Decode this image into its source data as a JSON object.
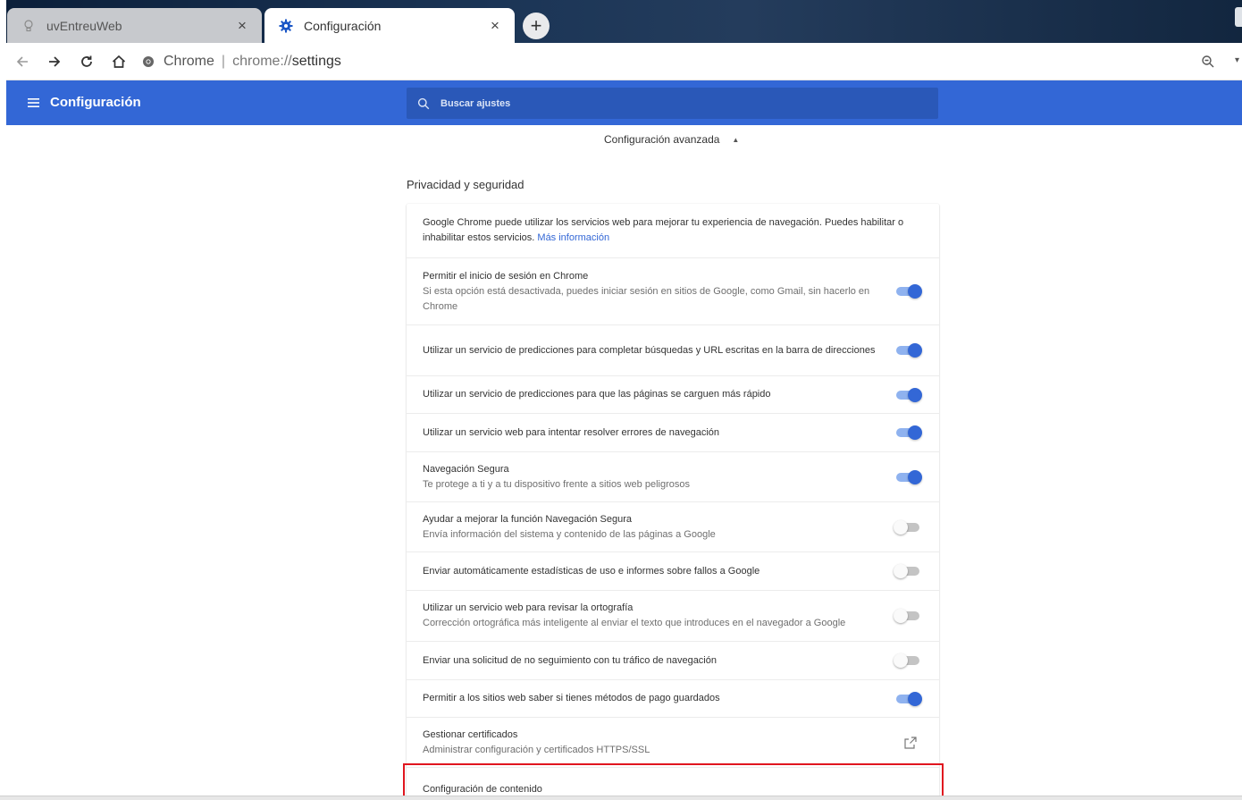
{
  "tabs": [
    {
      "title": "uvEntreuWeb",
      "icon": "bulb-icon",
      "active": false,
      "close": "×"
    },
    {
      "title": "Configuración",
      "icon": "gear-icon",
      "active": true,
      "close": "×"
    }
  ],
  "new_tab_label": "+",
  "toolbar": {
    "site_label": "Chrome",
    "separator": "|",
    "url_scheme": "chrome://",
    "url_path": "settings"
  },
  "header": {
    "title": "Configuración",
    "search_placeholder": "Buscar ajustes"
  },
  "advanced": {
    "label": "Configuración avanzada",
    "caret": "▲"
  },
  "section": {
    "title": "Privacidad y seguridad",
    "intro": "Google Chrome puede utilizar los servicios web para mejorar tu experiencia de navegación. Puedes habilitar o inhabilitar estos servicios.",
    "intro_link": "Más información",
    "rows": [
      {
        "label": "Permitir el inicio de sesión en Chrome",
        "sublabel": "Si esta opción está desactivada, puedes iniciar sesión en sitios de Google, como Gmail, sin hacerlo en Chrome",
        "control": "toggle",
        "enabled": true
      },
      {
        "label": "Utilizar un servicio de predicciones para completar búsquedas y URL escritas en la barra de direcciones",
        "control": "toggle",
        "enabled": true
      },
      {
        "label": "Utilizar un servicio de predicciones para que las páginas se carguen más rápido",
        "control": "toggle",
        "enabled": true
      },
      {
        "label": "Utilizar un servicio web para intentar resolver errores de navegación",
        "control": "toggle",
        "enabled": true
      },
      {
        "label": "Navegación Segura",
        "sublabel": "Te protege a ti y a tu dispositivo frente a sitios web peligrosos",
        "control": "toggle",
        "enabled": true
      },
      {
        "label": "Ayudar a mejorar la función Navegación Segura",
        "sublabel": "Envía información del sistema y contenido de las páginas a Google",
        "control": "toggle",
        "enabled": false
      },
      {
        "label": "Enviar automáticamente estadísticas de uso e informes sobre fallos a Google",
        "control": "toggle",
        "enabled": false
      },
      {
        "label": "Utilizar un servicio web para revisar la ortografía",
        "sublabel": "Corrección ortográfica más inteligente al enviar el texto que introduces en el navegador a Google",
        "control": "toggle",
        "enabled": false
      },
      {
        "label": "Enviar una solicitud de no seguimiento con tu tráfico de navegación",
        "control": "toggle",
        "enabled": false
      },
      {
        "label": "Permitir a los sitios web saber si tienes métodos de pago guardados",
        "control": "toggle",
        "enabled": true
      },
      {
        "label": "Gestionar certificados",
        "sublabel": "Administrar configuración y certificados HTTPS/SSL",
        "control": "external-link-icon"
      },
      {
        "label": "Configuración de contenido",
        "control": "chevron-right-icon",
        "chevron": "▸"
      }
    ]
  },
  "colors": {
    "accent": "#3367d6",
    "highlight": "#e0161f"
  }
}
